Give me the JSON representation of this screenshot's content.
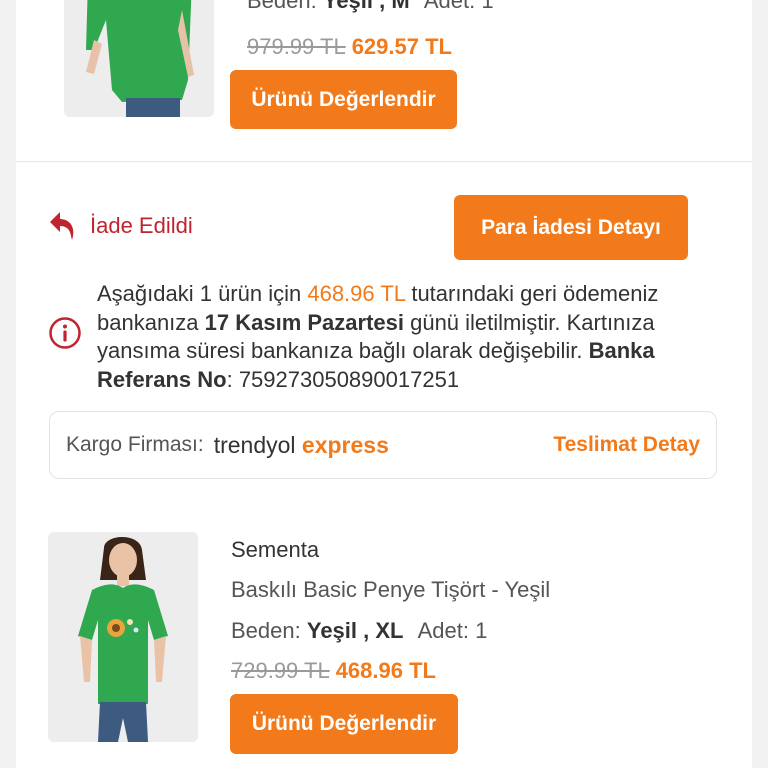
{
  "top_product": {
    "size_label": "Beden:",
    "size_value": "Yeşil , M",
    "qty_label": "Adet:",
    "qty_value": "1",
    "old_price": "979.99 TL",
    "new_price": "629.57 TL",
    "review_button": "Ürünü Değerlendir"
  },
  "refund": {
    "status_text": "İade Edildi",
    "detail_button": "Para İadesi Detayı",
    "notice_part1": "Aşağıdaki 1 ürün için ",
    "notice_amount": "468.96 TL",
    "notice_part2": " tutarındaki geri ödemeniz bankanıza ",
    "notice_date": "17 Kasım Pazartesi",
    "notice_part3": " günü iletilmiştir. Kartınıza yansıma süresi bankanıza bağlı olarak değişebilir. ",
    "notice_ref_label": "Banka Referans No",
    "notice_ref_value": ": 759273050890017251"
  },
  "cargo": {
    "label": "Kargo Firması:",
    "logo_part1": "trendyol",
    "logo_part2": " express",
    "link": "Teslimat Detay"
  },
  "product": {
    "brand": "Sementa",
    "name": "Baskılı Basic Penye Tişört - Yeşil",
    "size_label": "Beden:",
    "size_value": "Yeşil , XL",
    "qty_label": "Adet:",
    "qty_value": "1",
    "old_price": "729.99 TL",
    "new_price": "468.96 TL",
    "review_button": "Ürünü Değerlendir"
  },
  "colors": {
    "accent": "#f27a1a",
    "refund_red": "#c0242e",
    "shirt_green": "#2fa84f"
  }
}
